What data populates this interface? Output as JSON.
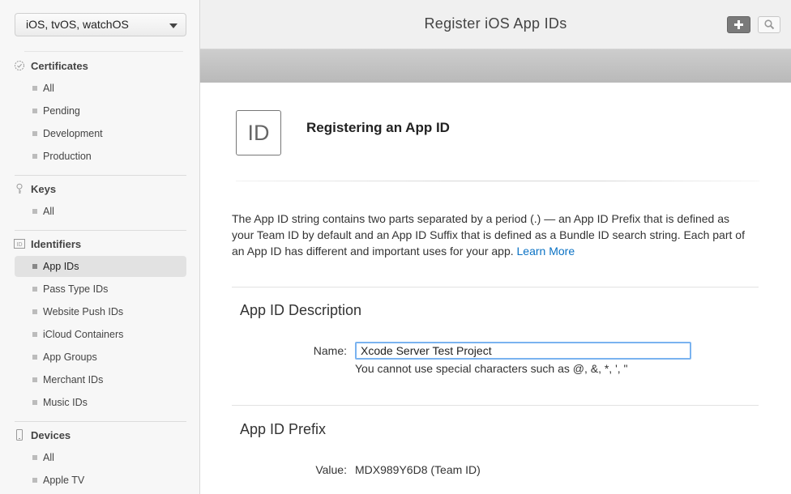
{
  "sidebar": {
    "platform_select": "iOS, tvOS, watchOS",
    "sections": {
      "certificates": {
        "label": "Certificates",
        "icon": "certificate-icon",
        "items": [
          "All",
          "Pending",
          "Development",
          "Production"
        ]
      },
      "keys": {
        "label": "Keys",
        "icon": "key-icon",
        "items": [
          "All"
        ]
      },
      "identifiers": {
        "label": "Identifiers",
        "icon": "id-icon",
        "items": [
          "App IDs",
          "Pass Type IDs",
          "Website Push IDs",
          "iCloud Containers",
          "App Groups",
          "Merchant IDs",
          "Music IDs"
        ],
        "active": "App IDs"
      },
      "devices": {
        "label": "Devices",
        "icon": "device-icon",
        "items": [
          "All",
          "Apple TV"
        ]
      }
    }
  },
  "header": {
    "title": "Register iOS App IDs",
    "add_icon": "plus-icon",
    "search_icon": "search-icon"
  },
  "main": {
    "badge_text": "ID",
    "heading": "Registering an App ID",
    "intro_text": "The App ID string contains two parts separated by a period (.) — an App ID Prefix that is defined as your Team ID by default and an App ID Suffix that is defined as a Bundle ID search string. Each part of an App ID has different and important uses for your app.",
    "learn_more": "Learn More",
    "description_section": {
      "title": "App ID Description",
      "name_label": "Name:",
      "name_value": "Xcode Server Test Project",
      "hint": "You cannot use special characters such as @, &, *, ', \""
    },
    "prefix_section": {
      "title": "App ID Prefix",
      "value_label": "Value:",
      "value": "MDX989Y6D8 (Team ID)"
    }
  },
  "colors": {
    "link": "#0a72c4",
    "input_focus": "#7ab3f0",
    "subbar": "#c4c4c4"
  }
}
